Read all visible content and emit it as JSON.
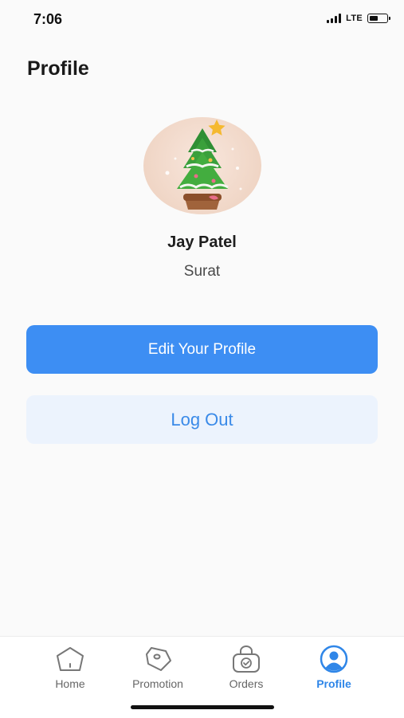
{
  "status": {
    "time": "7:06",
    "network": "LTE",
    "battery_level": 0.5
  },
  "header": {
    "title": "Profile"
  },
  "profile": {
    "name": "Jay Patel",
    "city": "Surat",
    "avatar_icon": "christmas-tree-icon"
  },
  "actions": {
    "edit_label": "Edit Your Profile",
    "logout_label": "Log Out"
  },
  "tabs": [
    {
      "label": "Home",
      "icon": "home-icon",
      "active": false
    },
    {
      "label": "Promotion",
      "icon": "tag-icon",
      "active": false
    },
    {
      "label": "Orders",
      "icon": "shopping-bag-icon",
      "active": false
    },
    {
      "label": "Profile",
      "icon": "user-circle-icon",
      "active": true
    }
  ],
  "colors": {
    "accent": "#3d8ef3",
    "logout_bg": "#ecf3fd",
    "tab_active": "#2f86e8",
    "tab_inactive": "#666666"
  }
}
